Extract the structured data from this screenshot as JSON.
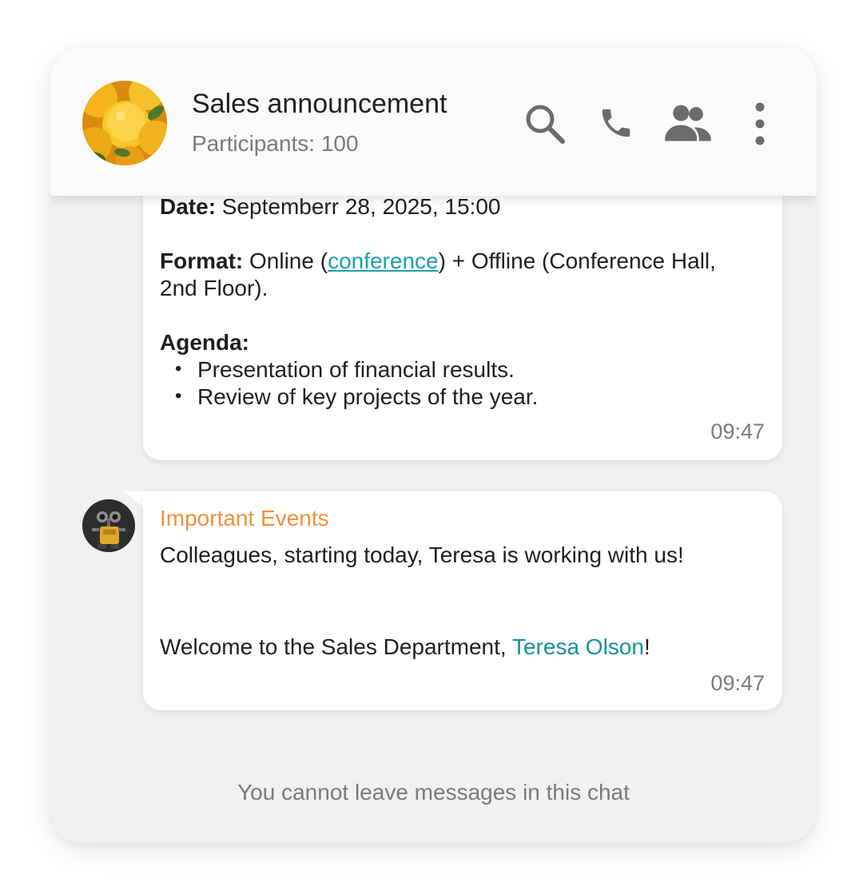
{
  "header": {
    "title": "Sales announcement",
    "participants": "Participants: 100",
    "icons": [
      "search-icon",
      "phone-icon",
      "participants-icon",
      "more-vert-icon"
    ]
  },
  "messages": [
    {
      "date_label": "Date:",
      "date_value": " Septemberr 28, 2025, 15:00",
      "format_label": "Format:",
      "format_pre": " Online (",
      "format_link": "conference",
      "format_post": ") + Offline (Conference Hall,",
      "format_line2": "2nd Floor).",
      "agenda_label": "Agenda:",
      "agenda_items": [
        "Presentation of financial results.",
        "Review of key projects of the year."
      ],
      "time": "09:47"
    },
    {
      "sender": "Important Events",
      "line1": "Colleagues, starting today, Teresa is working with us!",
      "line2_pre": "Welcome to the Sales Department, ",
      "line2_mention": "Teresa Olson",
      "line2_post": "!",
      "time": "09:47"
    }
  ],
  "footer": {
    "note": "You cannot leave messages in this chat"
  },
  "colors": {
    "sender_name": "#f0913a",
    "link": "#1ba0b0",
    "mention": "#14929e",
    "background": "#f1f1f1"
  }
}
